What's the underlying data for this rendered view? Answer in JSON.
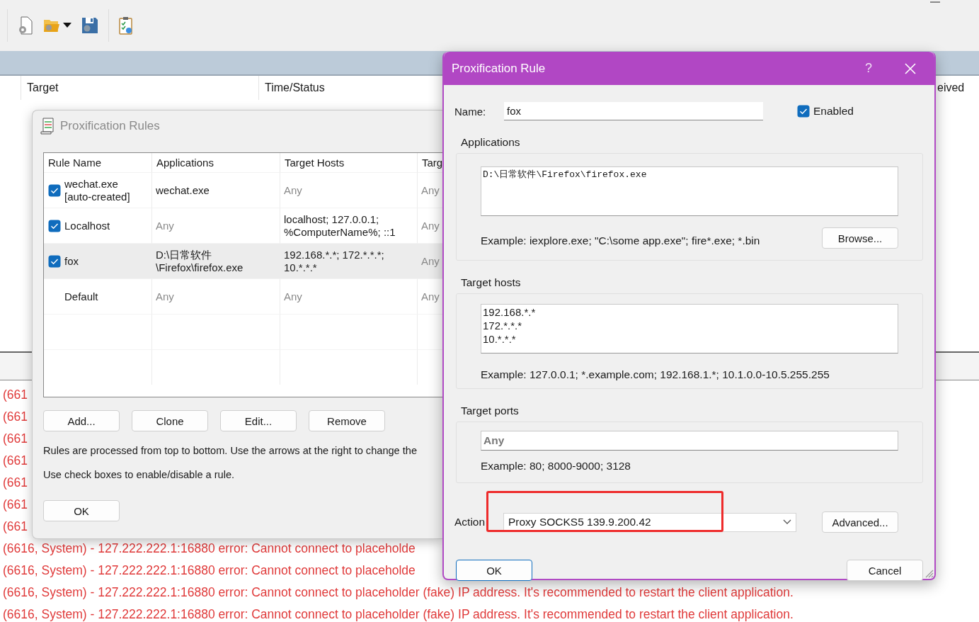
{
  "window": {
    "columns": [
      {
        "label": "Target"
      },
      {
        "label": "Time/Status"
      },
      {
        "label": "eived"
      }
    ]
  },
  "log": {
    "lines": [
      {
        "text": "(661"
      },
      {
        "text": "(661"
      },
      {
        "text": "(661"
      },
      {
        "text": "(661"
      },
      {
        "text": "(661"
      },
      {
        "text": "(661"
      },
      {
        "text": "(661"
      },
      {
        "text": "(6616, System) - 127.222.222.1:16880 error: Cannot connect to placeholde"
      },
      {
        "text": "(6616, System) - 127.222.222.1:16880 error: Cannot connect to placeholde"
      },
      {
        "text": "(6616, System) - 127.222.222.1:16880 error: Cannot connect to placeholder (fake) IP address. It's recommended to restart the client application."
      },
      {
        "text": "(6616, System) - 127.222.222.1:16880 error: Cannot connect to placeholder (fake) IP address. It's recommended to restart the client application."
      }
    ]
  },
  "rules_dialog": {
    "title": "Proxification Rules",
    "columns": [
      "Rule Name",
      "Applications",
      "Target Hosts",
      "Targ"
    ],
    "rows": [
      {
        "kind": "rule",
        "checked": true,
        "selected": false,
        "cells": [
          {
            "text": "wechat.exe [auto-created]",
            "dim": false
          },
          {
            "text": "wechat.exe",
            "dim": false
          },
          {
            "text": "Any",
            "dim": true
          },
          {
            "text": "Any",
            "dim": true
          }
        ]
      },
      {
        "kind": "rule",
        "checked": true,
        "selected": false,
        "cells": [
          {
            "text": "Localhost",
            "dim": false
          },
          {
            "text": "Any",
            "dim": true
          },
          {
            "text": "localhost; 127.0.0.1; %ComputerName%; ::1",
            "dim": false
          },
          {
            "text": "Any",
            "dim": true
          }
        ]
      },
      {
        "kind": "rule",
        "checked": true,
        "selected": true,
        "cells": [
          {
            "text": "fox",
            "dim": false
          },
          {
            "text": "D:\\日常软件\\Firefox\\firefox.exe",
            "dim": false
          },
          {
            "text": "192.168.*.*; 172.*.*.*; 10.*.*.*",
            "dim": false
          },
          {
            "text": "Any",
            "dim": true
          }
        ]
      },
      {
        "kind": "default",
        "selected": false,
        "cells": [
          {
            "text": "Default",
            "dim": false
          },
          {
            "text": "Any",
            "dim": true
          },
          {
            "text": "Any",
            "dim": true
          },
          {
            "text": "Any",
            "dim": true
          }
        ]
      }
    ],
    "buttons": [
      "Add...",
      "Clone",
      "Edit...",
      "Remove"
    ],
    "notes": [
      "Rules are processed from top to bottom. Use the arrows at the right to change the",
      "Use check boxes to enable/disable a rule."
    ],
    "ok": "OK"
  },
  "rule_dialog": {
    "title": "Proxification Rule",
    "help": "?",
    "name": {
      "label": "Name:",
      "value": "fox"
    },
    "enabled": {
      "label": "Enabled",
      "checked": true
    },
    "applications": {
      "label": "Applications",
      "value": "D:\\日常软件\\Firefox\\firefox.exe",
      "example": "Example: iexplore.exe; \"C:\\some app.exe\"; fire*.exe; *.bin",
      "browse": "Browse..."
    },
    "target_hosts": {
      "label": "Target hosts",
      "value": "192.168.*.*\n172.*.*.*\n10.*.*.*",
      "example": "Example: 127.0.0.1; *.example.com; 192.168.1.*; 10.1.0.0-10.5.255.255"
    },
    "target_ports": {
      "label": "Target ports",
      "placeholder": "Any",
      "example": "Example: 80; 8000-9000; 3128"
    },
    "action": {
      "label": "Action",
      "value": "Proxy SOCKS5 139.9.200.42",
      "highlighted": true,
      "advanced": "Advanced..."
    },
    "buttons": [
      {
        "label": "OK",
        "default": true
      },
      {
        "label": "Cancel",
        "default": false
      }
    ]
  }
}
